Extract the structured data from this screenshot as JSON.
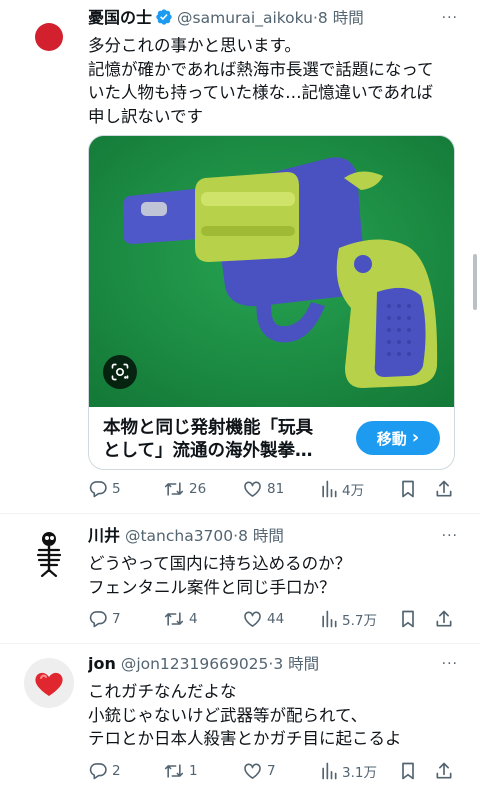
{
  "tweets": [
    {
      "name": "憂国の士",
      "handle": "@samurai_aikoku",
      "time": "·8 時間",
      "verified": true,
      "more": "···",
      "lines": [
        "多分これの事かと思います。",
        "記憶が確かであれば熱海市長選で話題になって",
        "いた人物も持っていた様な…記憶違いであれば",
        "申し訳ないです"
      ],
      "card": {
        "title_lines": [
          "本物と同じ発射機能「玩具",
          "として」流通の海外製拳…"
        ],
        "button_label": "移動",
        "button_arrow": "›"
      },
      "stats": {
        "replies": "5",
        "retweets": "26",
        "likes": "81",
        "views": "4万"
      }
    },
    {
      "name": "川井",
      "handle": "@tancha3700",
      "time": "·8 時間",
      "more": "···",
      "lines": [
        "どうやって国内に持ち込めるのか？",
        "フェンタニル案件と同じ手口か？"
      ],
      "stats": {
        "replies": "7",
        "retweets": "4",
        "likes": "44",
        "views": "5.7万"
      }
    },
    {
      "name": "jon",
      "handle": "@jon12319669025",
      "time": "·3 時間",
      "more": "···",
      "lines": [
        "これガチなんだよな",
        "小銃じゃないけど武器等が配られて、",
        "テロとか日本人殺害とかガチ目に起こるよ"
      ],
      "stats": {
        "replies": "2",
        "retweets": "1",
        "likes": "7",
        "views": "3.1万"
      }
    }
  ],
  "colors": {
    "accent": "#1d9bf0",
    "muted_text": "#536471",
    "card_background": "#1d8f45",
    "flag_red": "#d3202f"
  },
  "icons": {
    "reply": "reply-icon",
    "retweet": "retweet-icon",
    "like": "heart-icon",
    "views": "views-icon",
    "bookmark": "bookmark-icon",
    "share": "share-icon"
  }
}
